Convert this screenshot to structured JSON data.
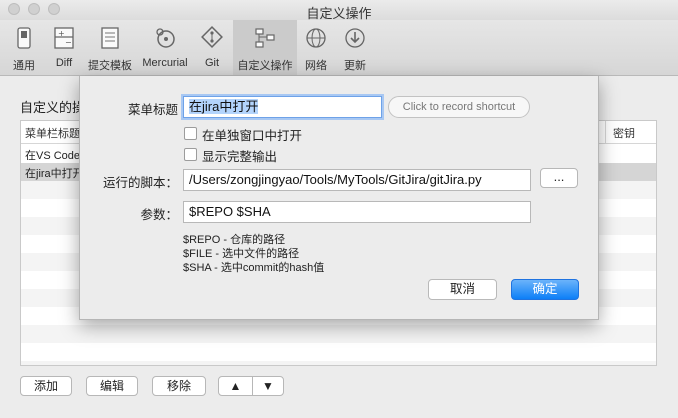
{
  "window": {
    "title": "自定义操作"
  },
  "toolbar": {
    "items": [
      {
        "label": "通用",
        "icon": "switch-icon"
      },
      {
        "label": "Diff",
        "icon": "diff-icon"
      },
      {
        "label": "提交模板",
        "icon": "document-icon"
      },
      {
        "label": "Mercurial",
        "icon": "mercurial-icon"
      },
      {
        "label": "Git",
        "icon": "git-icon"
      },
      {
        "label": "自定义操作",
        "icon": "custom-actions-icon",
        "active": true
      },
      {
        "label": "网络",
        "icon": "globe-icon"
      },
      {
        "label": "更新",
        "icon": "update-icon"
      }
    ]
  },
  "background": {
    "section_title": "自定义的操",
    "table": {
      "col_menu": "菜单栏标题",
      "col_key": "密钥",
      "rows": [
        "在VS Code",
        "在jira中打开"
      ]
    },
    "buttons": {
      "add": "添加",
      "edit": "编辑",
      "remove": "移除",
      "up": "▲",
      "down": "▼"
    }
  },
  "dialog": {
    "menu_title_label": "菜单标题",
    "menu_title_value": "在jira中打开",
    "shortcut_placeholder": "Click to record shortcut",
    "open_separate_window": "在单独窗口中打开",
    "show_full_output": "显示完整输出",
    "script_label": "运行的脚本：",
    "script_path": "/Users/zongjingyao/Tools/MyTools/GitJira/gitJira.py",
    "browse_label": "...",
    "params_label": "参数：",
    "params_value": "$REPO $SHA",
    "help_lines": [
      "$REPO - 仓库的路径",
      "$FILE - 选中文件的路径",
      "$SHA - 选中commit的hash值"
    ],
    "cancel_label": "取消",
    "ok_label": "确定"
  }
}
